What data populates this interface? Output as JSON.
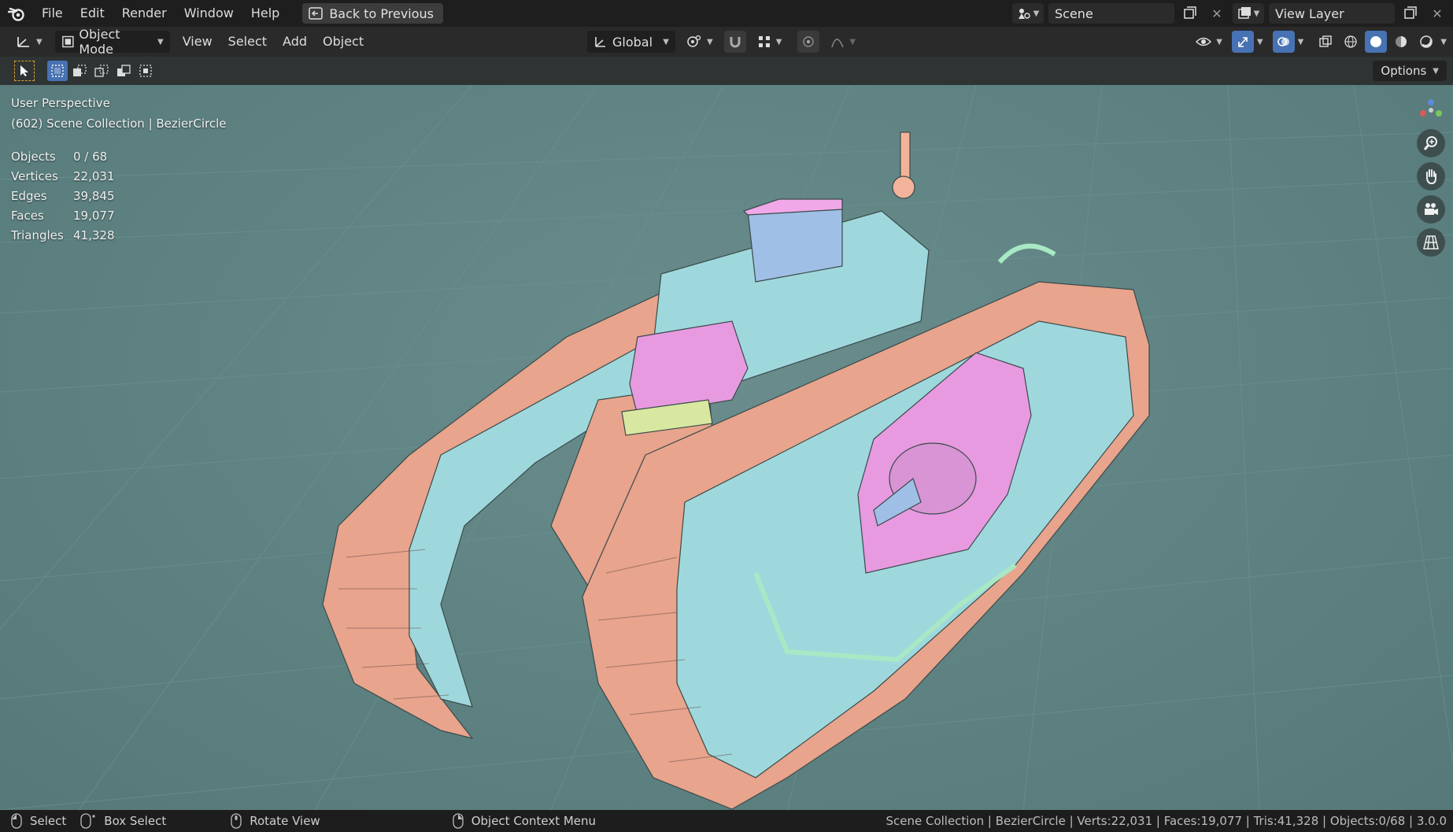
{
  "topbar": {
    "menus": [
      "File",
      "Edit",
      "Render",
      "Window",
      "Help"
    ],
    "back_button": "Back to Previous",
    "scene_name": "Scene",
    "view_layer": "View Layer"
  },
  "header": {
    "mode": "Object Mode",
    "menus": [
      "View",
      "Select",
      "Add",
      "Object"
    ],
    "transform_orientation": "Global"
  },
  "toolheader": {
    "options_label": "Options"
  },
  "viewport": {
    "perspective": "User Perspective",
    "collection_line": "(602) Scene Collection | BezierCircle",
    "stats": [
      {
        "label": "Objects",
        "value": "0 / 68"
      },
      {
        "label": "Vertices",
        "value": "22,031"
      },
      {
        "label": "Edges",
        "value": "39,845"
      },
      {
        "label": "Faces",
        "value": "19,077"
      },
      {
        "label": "Triangles",
        "value": "41,328"
      }
    ]
  },
  "statusbar": {
    "select": "Select",
    "box_select": "Box Select",
    "rotate_view": "Rotate View",
    "context_menu": "Object Context Menu",
    "info": "Scene Collection | BezierCircle | Verts:22,031 | Faces:19,077 | Tris:41,328 | Objects:0/68 | 3.0.0"
  },
  "colors": {
    "accent": "#4772b3",
    "viewport_bg": "#5e8282",
    "track": "#e8a48c",
    "hull": "#9fd8dc",
    "turret": "#e79ae0",
    "trim": "#a9e8c4"
  }
}
